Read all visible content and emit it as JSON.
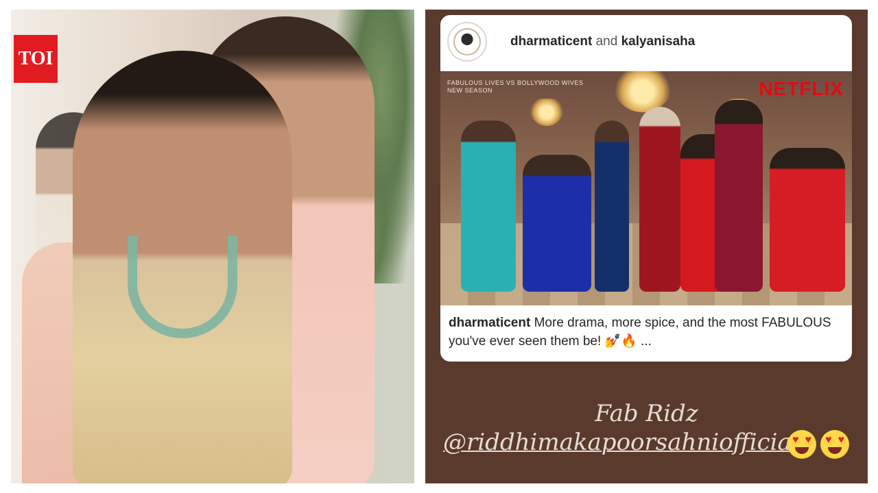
{
  "left_photo": {
    "logo_text": "TOI",
    "logo_color": "#e21b22"
  },
  "story": {
    "background_color": "#5a3a2d",
    "post": {
      "header": {
        "user1": "dharmaticent",
        "connector": "and",
        "user2": "kalyanisaha"
      },
      "image": {
        "brand": "NETFLIX",
        "brand_color": "#e50914",
        "show_title": "FABULOUS LIVES VS BOLLYWOOD WIVES",
        "badge": "NEW SEASON"
      },
      "caption": {
        "user": "dharmaticent",
        "text": "More drama, more spice, and the most FABULOUS you've ever seen them be! 💅🔥 ..."
      }
    },
    "overlay": {
      "line1": "Fab Ridz",
      "mention": "@riddhimakapoorsahniofficial",
      "emojis": [
        "heart-eyes-emoji",
        "heart-eyes-emoji"
      ]
    }
  }
}
